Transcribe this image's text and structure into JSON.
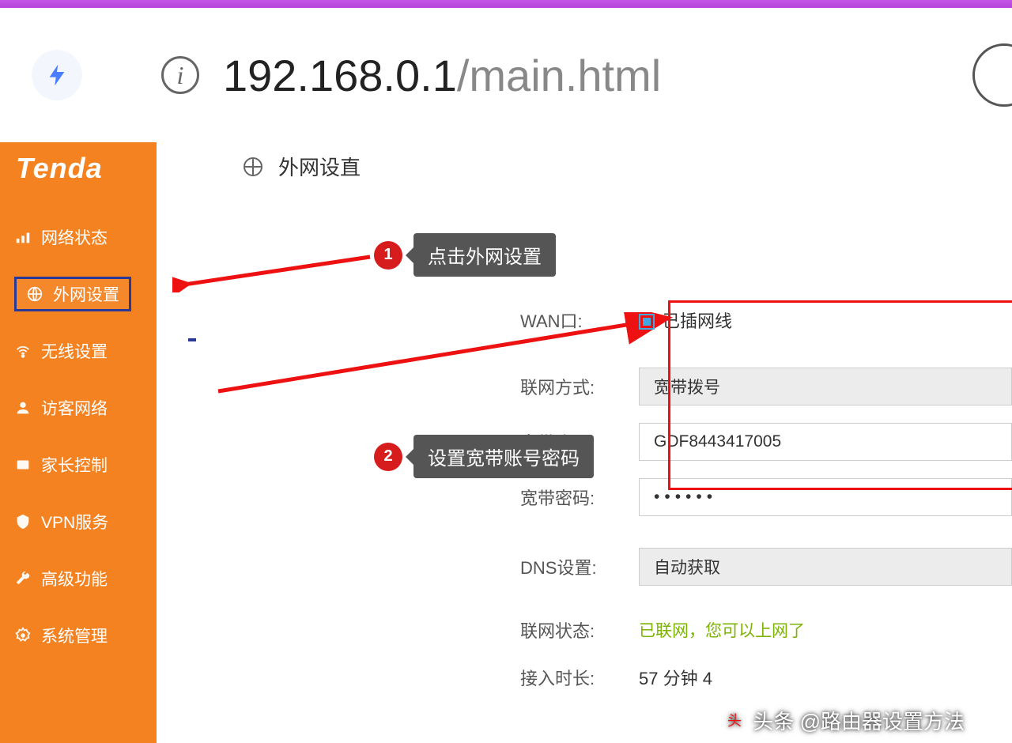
{
  "url": {
    "host": "192.168.0.1",
    "path": "/main.html"
  },
  "brand": "Tenda",
  "pageTitle": "外网设直",
  "sidebar": {
    "items": [
      {
        "label": "网络状态",
        "icon": "status"
      },
      {
        "label": "外网设置",
        "icon": "globe",
        "active": true
      },
      {
        "label": "无线设置",
        "icon": "wifi"
      },
      {
        "label": "访客网络",
        "icon": "guest"
      },
      {
        "label": "家长控制",
        "icon": "parent"
      },
      {
        "label": "VPN服务",
        "icon": "vpn"
      },
      {
        "label": "高级功能",
        "icon": "wrench"
      },
      {
        "label": "系统管理",
        "icon": "gear"
      }
    ]
  },
  "callouts": {
    "c1": {
      "num": "1",
      "text": "点击外网设置"
    },
    "c2": {
      "num": "2",
      "text": "设置宽带账号密码"
    }
  },
  "form": {
    "wanLabel": "WAN口:",
    "wanStatus": "已插网线",
    "connTypeLabel": "联网方式:",
    "connTypeValue": "宽带拨号",
    "accountLabel": "宽带账号:",
    "accountValue": "GDF8443417005",
    "passwordLabel": "宽带密码:",
    "passwordValue": "••••••",
    "dnsLabel": "DNS设置:",
    "dnsValue": "自动获取",
    "statusLabel": "联网状态:",
    "statusValue": "已联网，您可以上网了",
    "durationLabel": "接入时长:",
    "durationValue": "57 分钟 4"
  },
  "footer": {
    "prefix": "头条",
    "text": "@路由器设置方法"
  }
}
